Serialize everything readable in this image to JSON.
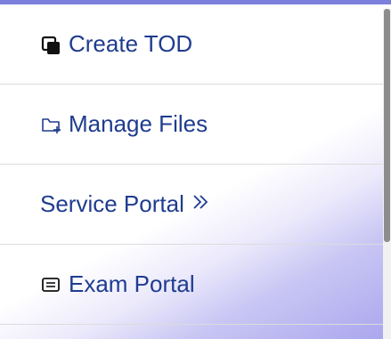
{
  "menu": {
    "items": [
      {
        "label": "Create TOD",
        "icon": "copy-icon"
      },
      {
        "label": "Manage Files",
        "icon": "folder-add-icon"
      },
      {
        "label": "Service Portal",
        "icon": "chevron-double-right-icon"
      },
      {
        "label": "Exam Portal",
        "icon": "message-square-icon"
      }
    ]
  },
  "colors": {
    "text": "#1f3c8f",
    "accent": "#7c7fdc"
  }
}
